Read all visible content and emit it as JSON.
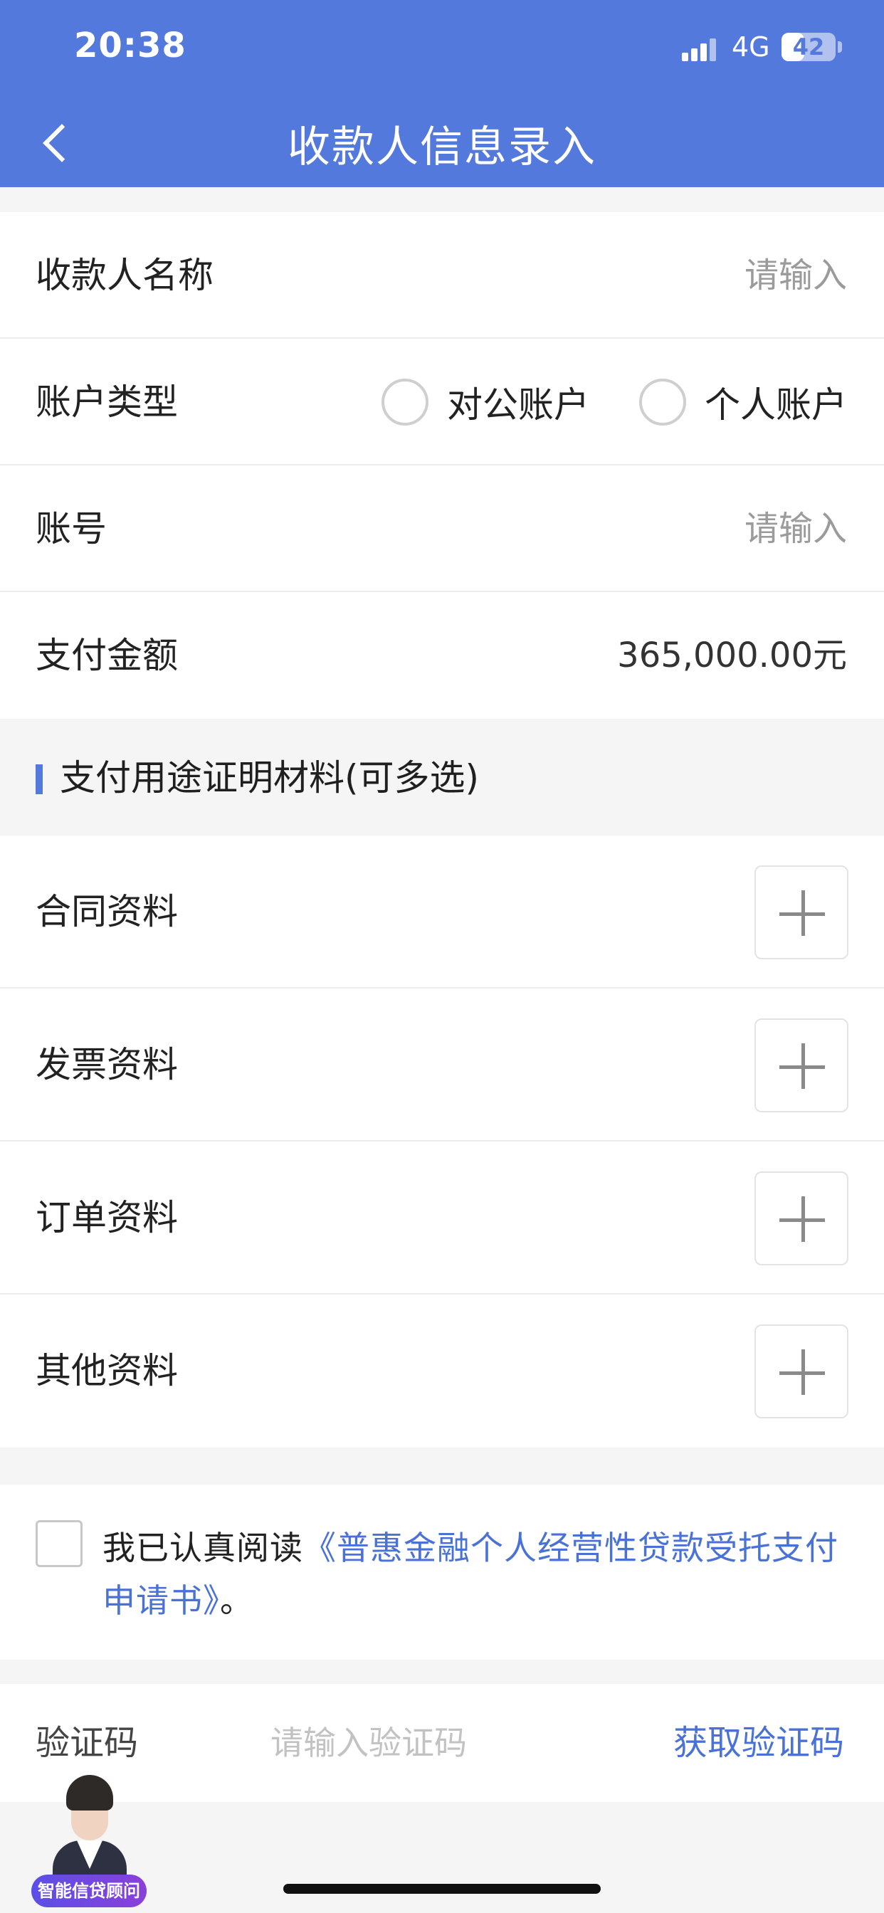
{
  "status_bar": {
    "time": "20:38",
    "network": "4G",
    "battery": "42",
    "battery_level": 0.42
  },
  "header": {
    "title": "收款人信息录入",
    "back_icon": "chevron-left-icon"
  },
  "form": {
    "payee_name": {
      "label": "收款人名称",
      "placeholder": "请输入"
    },
    "account_type": {
      "label": "账户类型",
      "options": [
        "对公账户",
        "个人账户"
      ],
      "selected": null
    },
    "account_number": {
      "label": "账号",
      "placeholder": "请输入"
    },
    "payment_amount": {
      "label": "支付金额",
      "value": "365,000.00元"
    }
  },
  "materials": {
    "section_title": "支付用途证明材料(可多选)",
    "items": [
      {
        "label": "合同资料",
        "icon": "plus-icon"
      },
      {
        "label": "发票资料",
        "icon": "plus-icon"
      },
      {
        "label": "订单资料",
        "icon": "plus-icon"
      },
      {
        "label": "其他资料",
        "icon": "plus-icon"
      }
    ]
  },
  "agreement": {
    "prefix": "我已认真阅读",
    "link": "《普惠金融个人经营性贷款受托支付申请书》",
    "suffix": "。",
    "checked": false
  },
  "verification": {
    "label": "验证码",
    "placeholder": "请输入验证码",
    "button": "获取验证码"
  },
  "assistant": {
    "badge": "智能信贷顾问"
  },
  "colors": {
    "primary": "#5479dc",
    "link": "#4a72d6",
    "background": "#f5f5f5"
  }
}
